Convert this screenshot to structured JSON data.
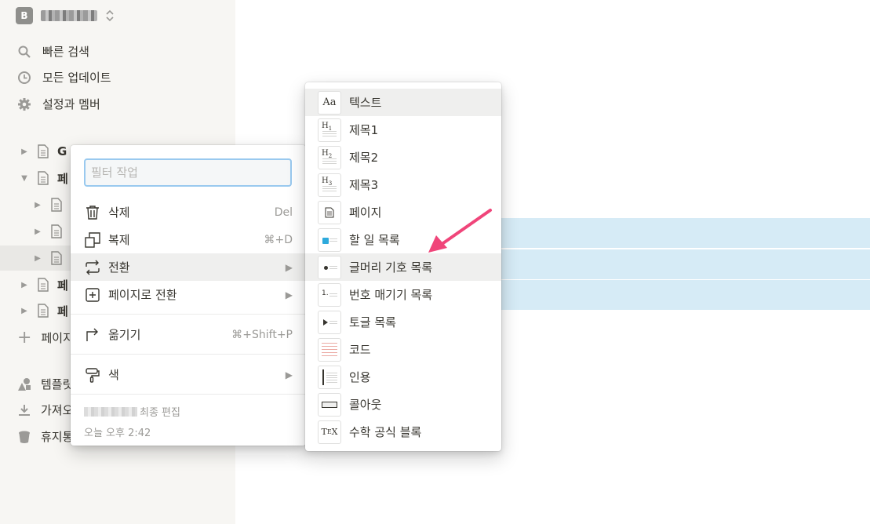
{
  "sidebar": {
    "workspace_initial": "B",
    "workspace_switch_icon": "⌃⌄",
    "nav": [
      {
        "label": "빠른 검색",
        "icon": "search-icon"
      },
      {
        "label": "모든 업데이트",
        "icon": "clock-icon"
      },
      {
        "label": "설정과 멤버",
        "icon": "gear-icon"
      }
    ],
    "tree": [
      {
        "label": "G",
        "expanded": false
      },
      {
        "label": "페",
        "expanded": true
      },
      {
        "label": "",
        "expanded": false
      },
      {
        "label": "",
        "expanded": false
      },
      {
        "label": "",
        "expanded": false,
        "active": true
      },
      {
        "label": "페",
        "expanded": false
      },
      {
        "label": "페",
        "expanded": false
      }
    ],
    "add_page": "페이지",
    "bottom": [
      {
        "label": "템플릿",
        "icon": "shapes-icon"
      },
      {
        "label": "가져오",
        "icon": "download-icon"
      },
      {
        "label": "휴지통",
        "icon": "trash-icon"
      }
    ]
  },
  "context_menu": {
    "filter_placeholder": "필터 작업",
    "items": [
      {
        "label": "삭제",
        "shortcut": "Del",
        "icon": "trash-icon"
      },
      {
        "label": "복제",
        "shortcut": "⌘+D",
        "icon": "duplicate-icon"
      },
      {
        "label": "전환",
        "shortcut": "▶",
        "icon": "convert-icon"
      },
      {
        "label": "페이지로 전환",
        "shortcut": "▶",
        "icon": "turn-into-page-icon"
      },
      {
        "label": "옮기기",
        "shortcut": "⌘+Shift+P",
        "icon": "move-icon"
      },
      {
        "label": "색",
        "shortcut": "▶",
        "icon": "paint-roller-icon"
      }
    ],
    "last_edited_label": "최종 편집",
    "last_edited_time": "오늘 오후 2:42"
  },
  "turn_into_menu": {
    "items": [
      {
        "label": "텍스트",
        "thumb": "Aa"
      },
      {
        "label": "제목1",
        "thumb": "H1"
      },
      {
        "label": "제목2",
        "thumb": "H2"
      },
      {
        "label": "제목3",
        "thumb": "H3"
      },
      {
        "label": "페이지",
        "thumb": "page"
      },
      {
        "label": "할 일 목록",
        "thumb": "todo"
      },
      {
        "label": "글머리 기호 목록",
        "thumb": "bullet"
      },
      {
        "label": "번호 매기기 목록",
        "thumb": "1."
      },
      {
        "label": "토글 목록",
        "thumb": "toggle"
      },
      {
        "label": "코드",
        "thumb": "code"
      },
      {
        "label": "인용",
        "thumb": "quote"
      },
      {
        "label": "콜아웃",
        "thumb": "callout"
      },
      {
        "label": "수학 공식 블록",
        "thumb": "TeX"
      }
    ],
    "selected": "텍스트",
    "hovered": "글머리 기호 목록"
  },
  "colors": {
    "sidebar_bg": "#f7f6f3",
    "selection_band": "#d6ebf6",
    "filter_focus": "#99c9ef",
    "arrow": "#f0457a"
  }
}
